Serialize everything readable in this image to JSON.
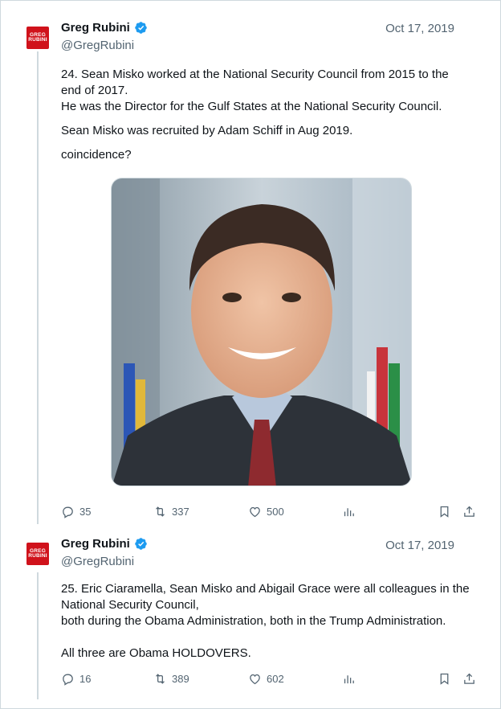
{
  "tweets": [
    {
      "name": "Greg Rubini",
      "handle": "@GregRubini",
      "date": "Oct 17, 2019",
      "avatar_text": [
        "GREG",
        "RUBINI"
      ],
      "paragraphs": [
        "24. Sean Misko worked at the National Security Council from 2015 to the end of 2017.",
        "He was the Director for the Gulf States at the National Security Council.",
        "Sean Misko was recruited by Adam Schiff in Aug 2019.",
        "coincidence?"
      ],
      "has_image": true,
      "replies": "35",
      "retweets": "337",
      "likes": "500"
    },
    {
      "name": "Greg Rubini",
      "handle": "@GregRubini",
      "date": "Oct 17, 2019",
      "avatar_text": [
        "GREG",
        "RUBINI"
      ],
      "paragraphs": [
        "25. Eric Ciaramella, Sean Misko and Abigail Grace were all colleagues in the National Security Council,",
        "both during the Obama Administration, both in the Trump Administration.",
        "All three are Obama HOLDOVERS."
      ],
      "has_image": false,
      "replies": "16",
      "retweets": "389",
      "likes": "602"
    }
  ],
  "colors": {
    "verified": "#1d9bf0",
    "avatar_bg": "#d0121b",
    "muted": "#536471",
    "text": "#0f1419"
  }
}
